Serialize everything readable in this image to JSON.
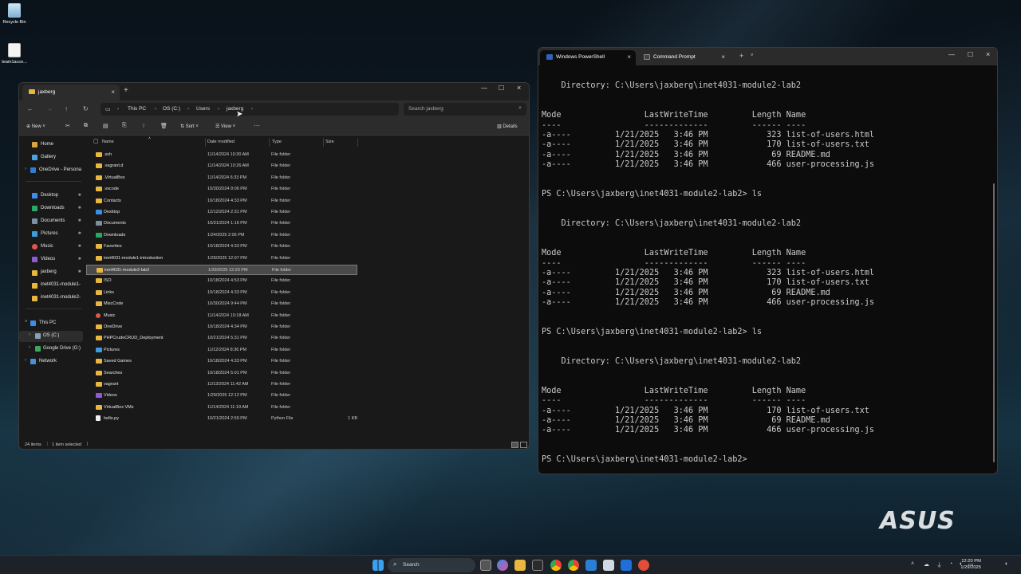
{
  "desktop": {
    "icons": [
      {
        "label": "Recycle Bin"
      },
      {
        "label": "team1acce..."
      }
    ]
  },
  "explorer": {
    "tab_title": "jaxberg",
    "breadcrumb": [
      "This PC",
      "OS (C:)",
      "Users",
      "jaxberg"
    ],
    "search_placeholder": "Search jaxberg",
    "toolbar": {
      "new": "New",
      "sort": "Sort",
      "view": "View",
      "details": "Details"
    },
    "sidebar": {
      "quick": [
        {
          "label": "Home"
        },
        {
          "label": "Gallery"
        },
        {
          "label": "OneDrive - Persona"
        }
      ],
      "pinned": [
        {
          "label": "Desktop"
        },
        {
          "label": "Downloads"
        },
        {
          "label": "Documents"
        },
        {
          "label": "Pictures"
        },
        {
          "label": "Music"
        },
        {
          "label": "Videos"
        },
        {
          "label": "jaxberg"
        },
        {
          "label": "inet4031-module1-"
        },
        {
          "label": "inet4031-module2-"
        }
      ],
      "devices": [
        {
          "label": "This PC"
        },
        {
          "label": "OS (C:)"
        },
        {
          "label": "Google Drive (G:)"
        },
        {
          "label": "Network"
        }
      ]
    },
    "columns": {
      "name": "Name",
      "date": "Date modified",
      "type": "Type",
      "size": "Size"
    },
    "files": [
      {
        "name": ".ssh",
        "date": "11/14/2024 10:30 AM",
        "type": "File folder",
        "size": ""
      },
      {
        "name": ".vagrant.d",
        "date": "11/14/2024 10:26 AM",
        "type": "File folder",
        "size": ""
      },
      {
        "name": ".VirtualBox",
        "date": "11/14/2024 6:33 PM",
        "type": "File folder",
        "size": ""
      },
      {
        "name": ".vscode",
        "date": "10/30/2024 9:06 PM",
        "type": "File folder",
        "size": ""
      },
      {
        "name": "Contacts",
        "date": "10/18/2024 4:33 PM",
        "type": "File folder",
        "size": ""
      },
      {
        "name": "Desktop",
        "date": "12/12/2024 2:31 PM",
        "type": "File folder",
        "size": ""
      },
      {
        "name": "Documents",
        "date": "10/31/2024 1:16 PM",
        "type": "File folder",
        "size": ""
      },
      {
        "name": "Downloads",
        "date": "1/24/2025 2:05 PM",
        "type": "File folder",
        "size": ""
      },
      {
        "name": "Favorites",
        "date": "10/18/2024 4:33 PM",
        "type": "File folder",
        "size": ""
      },
      {
        "name": "inet4031-module1-introduction",
        "date": "1/29/2025 12:07 PM",
        "type": "File folder",
        "size": ""
      },
      {
        "name": "inet4031-module2-lab2",
        "date": "1/29/2025 12:20 PM",
        "type": "File folder",
        "size": ""
      },
      {
        "name": "ISO",
        "date": "10/18/2024 4:53 PM",
        "type": "File folder",
        "size": ""
      },
      {
        "name": "Links",
        "date": "10/18/2024 4:33 PM",
        "type": "File folder",
        "size": ""
      },
      {
        "name": "MiscCode",
        "date": "10/30/2024 9:44 PM",
        "type": "File folder",
        "size": ""
      },
      {
        "name": "Music",
        "date": "11/14/2024 10:18 AM",
        "type": "File folder",
        "size": ""
      },
      {
        "name": "OneDrive",
        "date": "10/18/2024 4:34 PM",
        "type": "File folder",
        "size": ""
      },
      {
        "name": "PHPCrudeCRUD_Deployment",
        "date": "10/21/2024 5:31 PM",
        "type": "File folder",
        "size": ""
      },
      {
        "name": "Pictures",
        "date": "11/12/2024 8:36 PM",
        "type": "File folder",
        "size": ""
      },
      {
        "name": "Saved Games",
        "date": "10/18/2024 4:33 PM",
        "type": "File folder",
        "size": ""
      },
      {
        "name": "Searches",
        "date": "10/18/2024 5:01 PM",
        "type": "File folder",
        "size": ""
      },
      {
        "name": "vagrant",
        "date": "11/13/2024 11:42 AM",
        "type": "File folder",
        "size": ""
      },
      {
        "name": "Videos",
        "date": "1/29/2025 12:12 PM",
        "type": "File folder",
        "size": ""
      },
      {
        "name": "VirtualBox VMs",
        "date": "11/14/2024 11:19 AM",
        "type": "File folder",
        "size": ""
      },
      {
        "name": "hello.py",
        "date": "10/21/2024 2:59 PM",
        "type": "Python File",
        "size": "1 KB"
      }
    ],
    "status": {
      "count": "24 items",
      "selected": "1 item selected"
    }
  },
  "terminal": {
    "tabs": [
      {
        "label": "Windows PowerShell"
      },
      {
        "label": "Command Prompt"
      }
    ],
    "lines": [
      "",
      "    Directory: C:\\Users\\jaxberg\\inet4031-module2-lab2",
      "",
      "",
      "Mode                 LastWriteTime         Length Name",
      "----                 -------------         ------ ----",
      "-a----         1/21/2025   3:46 PM            323 list-of-users.html",
      "-a----         1/21/2025   3:46 PM            170 list-of-users.txt",
      "-a----         1/21/2025   3:46 PM             69 README.md",
      "-a----         1/21/2025   3:46 PM            466 user-processing.js",
      "",
      "",
      "PS C:\\Users\\jaxberg\\inet4031-module2-lab2> ls",
      "",
      "",
      "    Directory: C:\\Users\\jaxberg\\inet4031-module2-lab2",
      "",
      "",
      "Mode                 LastWriteTime         Length Name",
      "----                 -------------         ------ ----",
      "-a----         1/21/2025   3:46 PM            323 list-of-users.html",
      "-a----         1/21/2025   3:46 PM            170 list-of-users.txt",
      "-a----         1/21/2025   3:46 PM             69 README.md",
      "-a----         1/21/2025   3:46 PM            466 user-processing.js",
      "",
      "",
      "PS C:\\Users\\jaxberg\\inet4031-module2-lab2> ls",
      "",
      "",
      "    Directory: C:\\Users\\jaxberg\\inet4031-module2-lab2",
      "",
      "",
      "Mode                 LastWriteTime         Length Name",
      "----                 -------------         ------ ----",
      "-a----         1/21/2025   3:46 PM            170 list-of-users.txt",
      "-a----         1/21/2025   3:46 PM             69 README.md",
      "-a----         1/21/2025   3:46 PM            466 user-processing.js",
      "",
      "",
      "PS C:\\Users\\jaxberg\\inet4031-module2-lab2>"
    ]
  },
  "watermark": "ASUS",
  "taskbar": {
    "search_placeholder": "Search",
    "time": "12:20 PM",
    "date": "1/29/2025"
  },
  "colors": {
    "folder": "#e9b640",
    "selection": "#4a4a4a",
    "terminal_bg": "#0c0c0c",
    "accent": "#3b8eea"
  }
}
